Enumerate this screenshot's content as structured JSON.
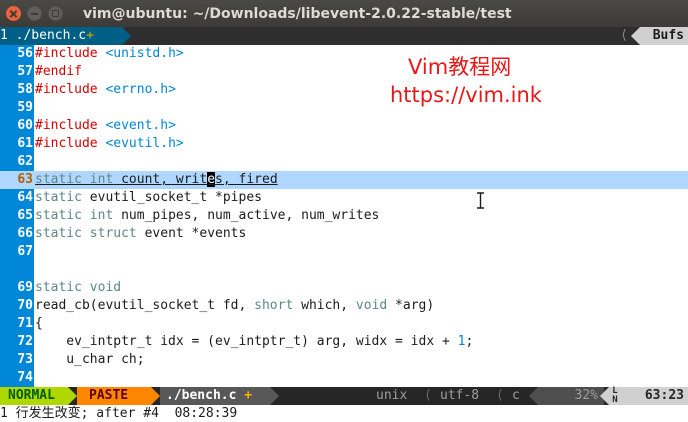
{
  "window": {
    "title": "vim@ubuntu: ~/Downloads/libevent-2.0.22-stable/test"
  },
  "tabline": {
    "tab_number": "1",
    "tab_label": "./bench.c",
    "tab_modified": "+",
    "bufs_label": "Bufs"
  },
  "watermark": {
    "line1": "Vim教程网",
    "line2": "https://vim.ink"
  },
  "editor": {
    "lines": [
      {
        "num": "56",
        "segs": [
          [
            "pp",
            "#include"
          ],
          [
            "",
            " "
          ],
          [
            "str",
            "<unistd.h>"
          ]
        ]
      },
      {
        "num": "57",
        "segs": [
          [
            "pp",
            "#endif"
          ]
        ]
      },
      {
        "num": "58",
        "segs": [
          [
            "pp",
            "#include"
          ],
          [
            "",
            " "
          ],
          [
            "str",
            "<errno.h>"
          ]
        ]
      },
      {
        "num": "59",
        "segs": []
      },
      {
        "num": "60",
        "segs": [
          [
            "pp",
            "#include"
          ],
          [
            "",
            " "
          ],
          [
            "str",
            "<event.h>"
          ]
        ]
      },
      {
        "num": "61",
        "segs": [
          [
            "pp",
            "#include"
          ],
          [
            "",
            " "
          ],
          [
            "str",
            "<evutil.h>"
          ]
        ]
      },
      {
        "num": "62",
        "segs": []
      },
      {
        "num": "63",
        "cursorline": true,
        "segs": [
          [
            "kw",
            "static"
          ],
          [
            "",
            " "
          ],
          [
            "ty",
            "int"
          ],
          [
            "",
            " count, writ"
          ],
          [
            "cur",
            "e"
          ],
          [
            "",
            "s, fired"
          ]
        ]
      },
      {
        "num": "64",
        "segs": [
          [
            "kw",
            "static"
          ],
          [
            "",
            " evutil_socket_t *pipes"
          ]
        ]
      },
      {
        "num": "65",
        "segs": [
          [
            "kw",
            "static"
          ],
          [
            "",
            " "
          ],
          [
            "ty",
            "int"
          ],
          [
            "",
            " num_pipes, num_active, num_writes"
          ]
        ]
      },
      {
        "num": "66",
        "segs": [
          [
            "kw",
            "static"
          ],
          [
            "",
            " "
          ],
          [
            "ty",
            "struct"
          ],
          [
            "",
            " event *events"
          ]
        ]
      },
      {
        "num": "67",
        "segs": []
      },
      {
        "num": "",
        "segs": []
      },
      {
        "num": "69",
        "segs": [
          [
            "kw",
            "static"
          ],
          [
            "",
            " "
          ],
          [
            "ty",
            "void"
          ]
        ]
      },
      {
        "num": "70",
        "segs": [
          [
            "",
            "read_cb(evutil_socket_t fd, "
          ],
          [
            "ty",
            "short"
          ],
          [
            "",
            " which, "
          ],
          [
            "ty",
            "void"
          ],
          [
            "",
            " *arg)"
          ]
        ]
      },
      {
        "num": "71",
        "segs": [
          [
            "",
            "{"
          ]
        ]
      },
      {
        "num": "72",
        "segs": [
          [
            "",
            "    ev_intptr_t idx = (ev_intptr_t) arg, widx = idx + "
          ],
          [
            "num",
            "1"
          ],
          [
            "",
            ";"
          ]
        ]
      },
      {
        "num": "73",
        "segs": [
          [
            "",
            "    u_char ch;"
          ]
        ]
      },
      {
        "num": "74",
        "segs": []
      }
    ]
  },
  "statusline": {
    "mode": "NORMAL",
    "paste": "PASTE",
    "filename": "./bench.c",
    "modified": "+",
    "fileformat": "unix",
    "encoding": "utf-8",
    "filetype": "c",
    "percent": "32%",
    "position": "63:23",
    "line_icon_l": "L",
    "line_icon_n": "N"
  },
  "cmdline": {
    "message": "1 行发生改变; after #4  08:28:39"
  },
  "colors": {
    "accent_blue": "#0087d7",
    "mode_green": "#afd700",
    "paste_orange": "#ff8700",
    "cursorline": "#afd7ff",
    "watermark_red": "#e81818"
  }
}
